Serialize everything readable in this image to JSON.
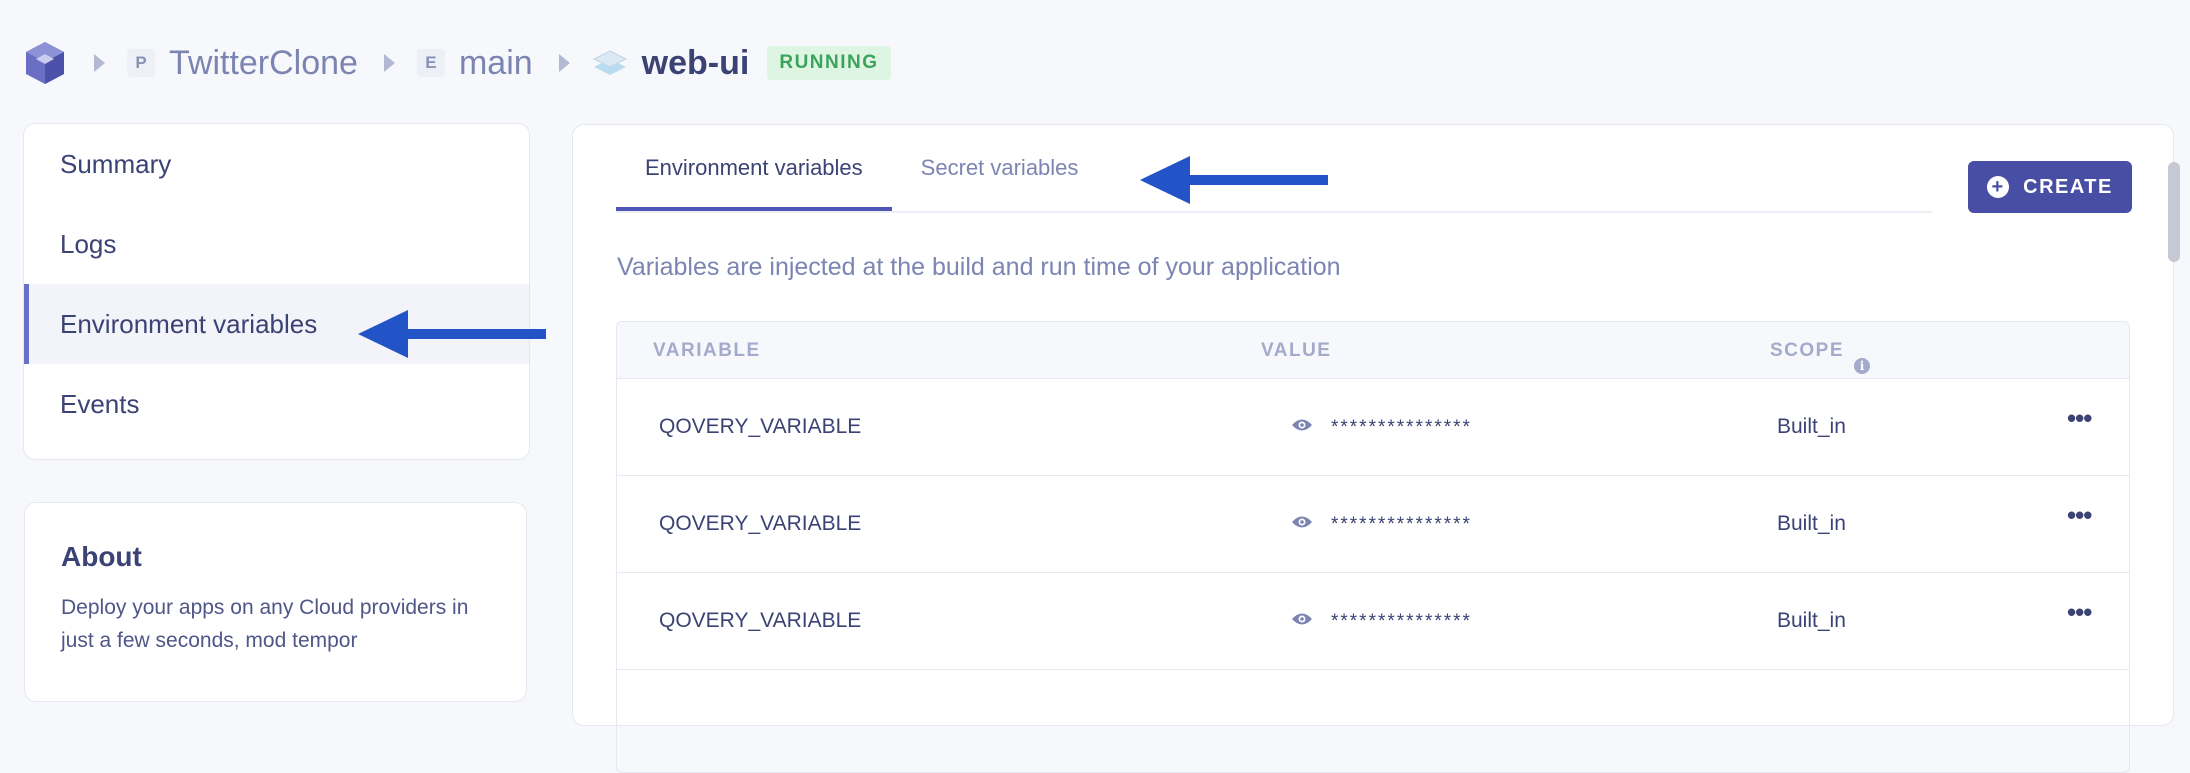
{
  "breadcrumb": {
    "project": {
      "badge": "P",
      "label": "TwitterClone"
    },
    "environment": {
      "badge": "E",
      "label": "main"
    },
    "application": {
      "label": "web-ui",
      "status": "RUNNING"
    }
  },
  "sidebar": {
    "items": [
      {
        "label": "Summary",
        "active": false
      },
      {
        "label": "Logs",
        "active": false
      },
      {
        "label": "Environment variables",
        "active": true
      },
      {
        "label": "Events",
        "active": false
      }
    ]
  },
  "about": {
    "title": "About",
    "text": "Deploy your apps on any Cloud providers in just a few seconds, mod tempor"
  },
  "tabs": [
    {
      "label": "Environment variables",
      "active": true
    },
    {
      "label": "Secret variables",
      "active": false
    }
  ],
  "create_label": "CREATE",
  "description": "Variables are injected at the build and run time of your application",
  "table": {
    "headers": {
      "variable": "VARIABLE",
      "value": "VALUE",
      "scope": "SCOPE"
    },
    "rows": [
      {
        "variable": "QOVERY_VARIABLE",
        "value": "***************",
        "scope": "Built_in"
      },
      {
        "variable": "QOVERY_VARIABLE",
        "value": "***************",
        "scope": "Built_in"
      },
      {
        "variable": "QOVERY_VARIABLE",
        "value": "***************",
        "scope": "Built_in"
      }
    ]
  },
  "icons": {
    "logo": "qovery-logo-icon",
    "separator": "chevron-right-icon",
    "application": "layers-icon",
    "create": "plus-circle-icon",
    "scope_info": "info-icon",
    "reveal": "eye-icon",
    "row_menu": "more-horizontal-icon",
    "annotation": "arrow-left-icon"
  },
  "colors": {
    "accent": "#474ea3",
    "status_bg": "#dff5e3",
    "status_text": "#3aa45b",
    "annotation_arrow": "#2254c8"
  }
}
